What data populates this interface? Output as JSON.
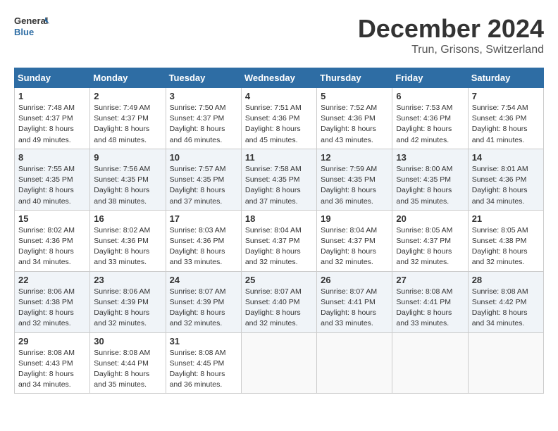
{
  "header": {
    "logo_line1": "General",
    "logo_line2": "Blue",
    "month": "December 2024",
    "location": "Trun, Grisons, Switzerland"
  },
  "weekdays": [
    "Sunday",
    "Monday",
    "Tuesday",
    "Wednesday",
    "Thursday",
    "Friday",
    "Saturday"
  ],
  "weeks": [
    [
      {
        "day": "1",
        "sunrise": "Sunrise: 7:48 AM",
        "sunset": "Sunset: 4:37 PM",
        "daylight": "Daylight: 8 hours and 49 minutes."
      },
      {
        "day": "2",
        "sunrise": "Sunrise: 7:49 AM",
        "sunset": "Sunset: 4:37 PM",
        "daylight": "Daylight: 8 hours and 48 minutes."
      },
      {
        "day": "3",
        "sunrise": "Sunrise: 7:50 AM",
        "sunset": "Sunset: 4:37 PM",
        "daylight": "Daylight: 8 hours and 46 minutes."
      },
      {
        "day": "4",
        "sunrise": "Sunrise: 7:51 AM",
        "sunset": "Sunset: 4:36 PM",
        "daylight": "Daylight: 8 hours and 45 minutes."
      },
      {
        "day": "5",
        "sunrise": "Sunrise: 7:52 AM",
        "sunset": "Sunset: 4:36 PM",
        "daylight": "Daylight: 8 hours and 43 minutes."
      },
      {
        "day": "6",
        "sunrise": "Sunrise: 7:53 AM",
        "sunset": "Sunset: 4:36 PM",
        "daylight": "Daylight: 8 hours and 42 minutes."
      },
      {
        "day": "7",
        "sunrise": "Sunrise: 7:54 AM",
        "sunset": "Sunset: 4:36 PM",
        "daylight": "Daylight: 8 hours and 41 minutes."
      }
    ],
    [
      {
        "day": "8",
        "sunrise": "Sunrise: 7:55 AM",
        "sunset": "Sunset: 4:35 PM",
        "daylight": "Daylight: 8 hours and 40 minutes."
      },
      {
        "day": "9",
        "sunrise": "Sunrise: 7:56 AM",
        "sunset": "Sunset: 4:35 PM",
        "daylight": "Daylight: 8 hours and 38 minutes."
      },
      {
        "day": "10",
        "sunrise": "Sunrise: 7:57 AM",
        "sunset": "Sunset: 4:35 PM",
        "daylight": "Daylight: 8 hours and 37 minutes."
      },
      {
        "day": "11",
        "sunrise": "Sunrise: 7:58 AM",
        "sunset": "Sunset: 4:35 PM",
        "daylight": "Daylight: 8 hours and 37 minutes."
      },
      {
        "day": "12",
        "sunrise": "Sunrise: 7:59 AM",
        "sunset": "Sunset: 4:35 PM",
        "daylight": "Daylight: 8 hours and 36 minutes."
      },
      {
        "day": "13",
        "sunrise": "Sunrise: 8:00 AM",
        "sunset": "Sunset: 4:35 PM",
        "daylight": "Daylight: 8 hours and 35 minutes."
      },
      {
        "day": "14",
        "sunrise": "Sunrise: 8:01 AM",
        "sunset": "Sunset: 4:36 PM",
        "daylight": "Daylight: 8 hours and 34 minutes."
      }
    ],
    [
      {
        "day": "15",
        "sunrise": "Sunrise: 8:02 AM",
        "sunset": "Sunset: 4:36 PM",
        "daylight": "Daylight: 8 hours and 34 minutes."
      },
      {
        "day": "16",
        "sunrise": "Sunrise: 8:02 AM",
        "sunset": "Sunset: 4:36 PM",
        "daylight": "Daylight: 8 hours and 33 minutes."
      },
      {
        "day": "17",
        "sunrise": "Sunrise: 8:03 AM",
        "sunset": "Sunset: 4:36 PM",
        "daylight": "Daylight: 8 hours and 33 minutes."
      },
      {
        "day": "18",
        "sunrise": "Sunrise: 8:04 AM",
        "sunset": "Sunset: 4:37 PM",
        "daylight": "Daylight: 8 hours and 32 minutes."
      },
      {
        "day": "19",
        "sunrise": "Sunrise: 8:04 AM",
        "sunset": "Sunset: 4:37 PM",
        "daylight": "Daylight: 8 hours and 32 minutes."
      },
      {
        "day": "20",
        "sunrise": "Sunrise: 8:05 AM",
        "sunset": "Sunset: 4:37 PM",
        "daylight": "Daylight: 8 hours and 32 minutes."
      },
      {
        "day": "21",
        "sunrise": "Sunrise: 8:05 AM",
        "sunset": "Sunset: 4:38 PM",
        "daylight": "Daylight: 8 hours and 32 minutes."
      }
    ],
    [
      {
        "day": "22",
        "sunrise": "Sunrise: 8:06 AM",
        "sunset": "Sunset: 4:38 PM",
        "daylight": "Daylight: 8 hours and 32 minutes."
      },
      {
        "day": "23",
        "sunrise": "Sunrise: 8:06 AM",
        "sunset": "Sunset: 4:39 PM",
        "daylight": "Daylight: 8 hours and 32 minutes."
      },
      {
        "day": "24",
        "sunrise": "Sunrise: 8:07 AM",
        "sunset": "Sunset: 4:39 PM",
        "daylight": "Daylight: 8 hours and 32 minutes."
      },
      {
        "day": "25",
        "sunrise": "Sunrise: 8:07 AM",
        "sunset": "Sunset: 4:40 PM",
        "daylight": "Daylight: 8 hours and 32 minutes."
      },
      {
        "day": "26",
        "sunrise": "Sunrise: 8:07 AM",
        "sunset": "Sunset: 4:41 PM",
        "daylight": "Daylight: 8 hours and 33 minutes."
      },
      {
        "day": "27",
        "sunrise": "Sunrise: 8:08 AM",
        "sunset": "Sunset: 4:41 PM",
        "daylight": "Daylight: 8 hours and 33 minutes."
      },
      {
        "day": "28",
        "sunrise": "Sunrise: 8:08 AM",
        "sunset": "Sunset: 4:42 PM",
        "daylight": "Daylight: 8 hours and 34 minutes."
      }
    ],
    [
      {
        "day": "29",
        "sunrise": "Sunrise: 8:08 AM",
        "sunset": "Sunset: 4:43 PM",
        "daylight": "Daylight: 8 hours and 34 minutes."
      },
      {
        "day": "30",
        "sunrise": "Sunrise: 8:08 AM",
        "sunset": "Sunset: 4:44 PM",
        "daylight": "Daylight: 8 hours and 35 minutes."
      },
      {
        "day": "31",
        "sunrise": "Sunrise: 8:08 AM",
        "sunset": "Sunset: 4:45 PM",
        "daylight": "Daylight: 8 hours and 36 minutes."
      },
      null,
      null,
      null,
      null
    ]
  ]
}
